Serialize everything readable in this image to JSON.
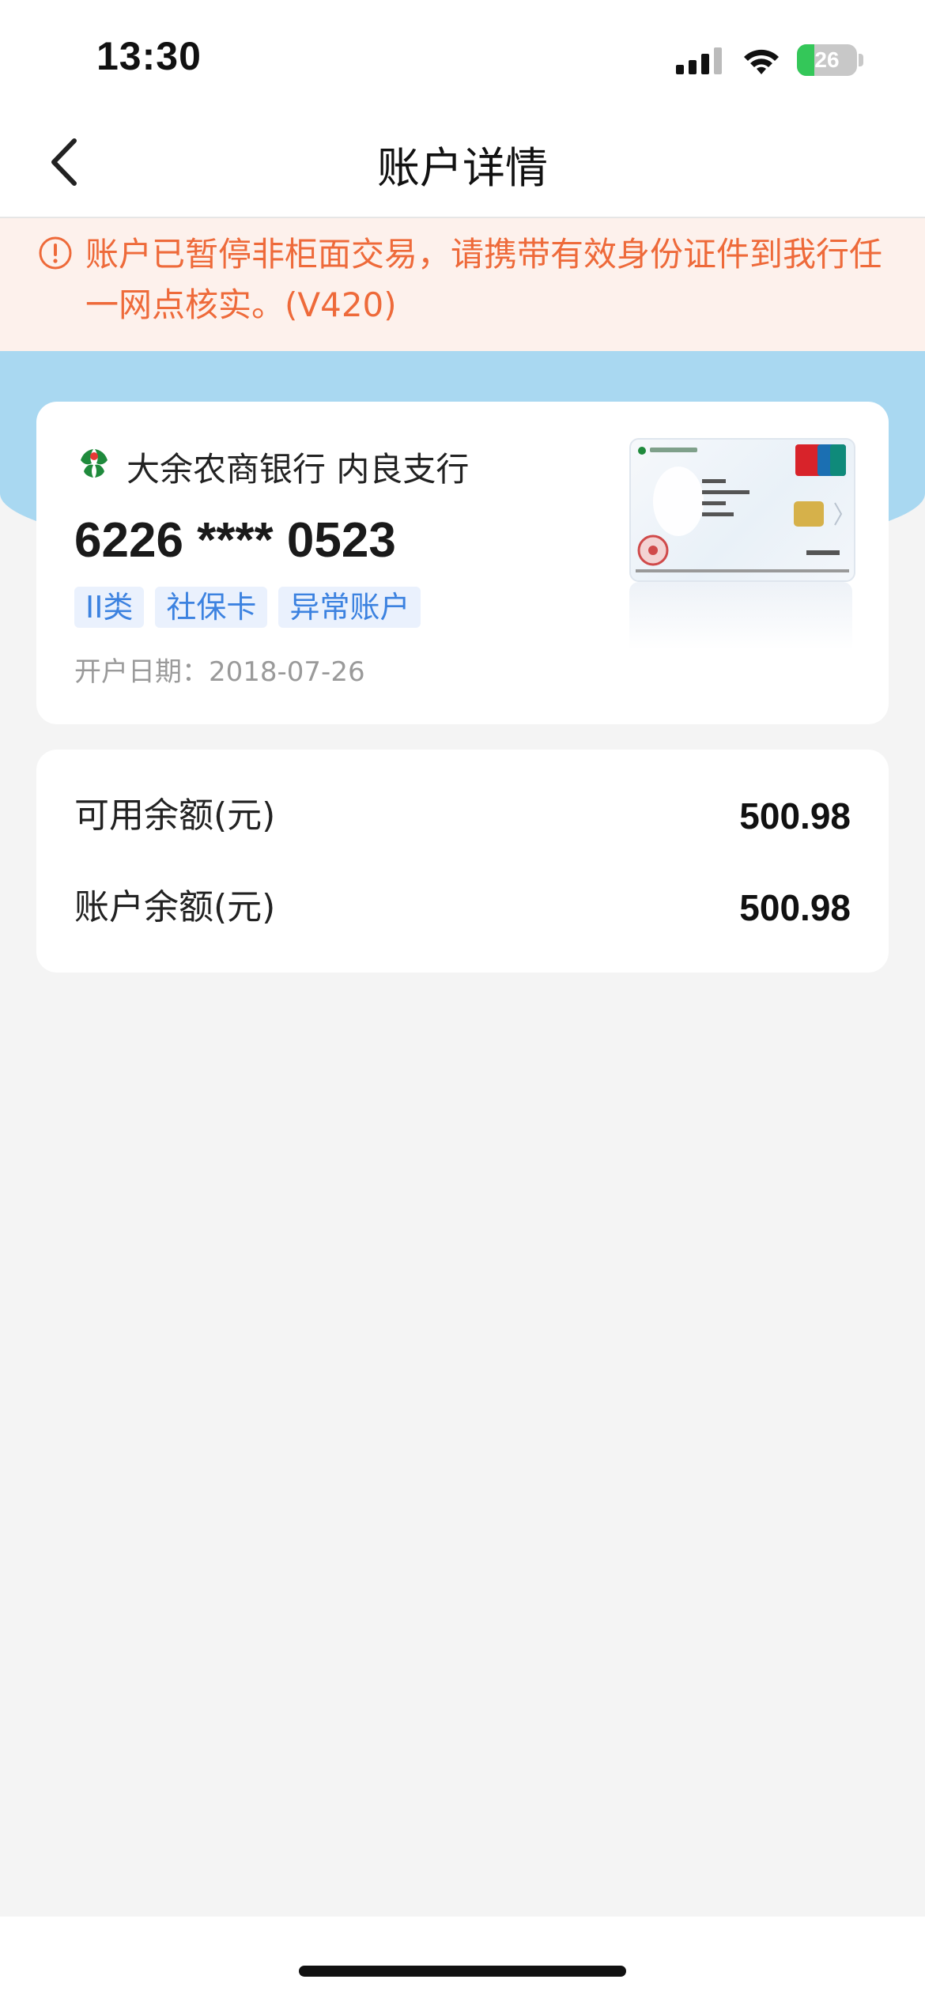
{
  "status_bar": {
    "time": "13:30",
    "battery": "26"
  },
  "nav": {
    "title": "账户详情"
  },
  "alert": {
    "message": "账户已暂停非柜面交易，请携带有效身份证件到我行任一网点核实。(V420)"
  },
  "account_card": {
    "bank_name": "大余农商银行  内良支行",
    "card_number": "6226 **** 0523",
    "tags": [
      "II类",
      "社保卡",
      "异常账户"
    ],
    "open_date": "开户日期：2018-07-26"
  },
  "balances": {
    "available_label": "可用余额(元)",
    "available_value": "500.98",
    "account_label": "账户余额(元)",
    "account_value": "500.98"
  },
  "colors": {
    "alert_text": "#ee6a3a",
    "alert_bg": "#fdf1ec",
    "band": "#a9d8f1",
    "tag_text": "#3c82e0",
    "tag_bg": "#eaf1fd",
    "bank_logo": "#1f8a3c"
  },
  "icons": {
    "back": "chevron-left-icon",
    "alert": "info-circle-icon",
    "bank_logo": "bank-logo-icon",
    "signal": "cellular-signal-icon",
    "wifi": "wifi-icon",
    "battery": "battery-icon"
  }
}
